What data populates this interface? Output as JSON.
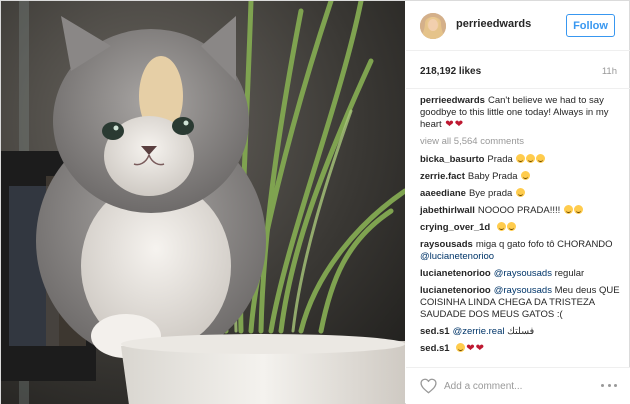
{
  "post": {
    "username": "perrieedwards",
    "follow_label": "Follow",
    "likes": "218,192 likes",
    "time": "11h",
    "caption_user": "perrieedwards",
    "caption_text": "Can't believe we had to say goodbye to this little one today! Always in my heart",
    "view_all": "view all 5,564 comments",
    "comments": [
      {
        "user": "bicka_basurto",
        "text": "Prada",
        "emojis": 3
      },
      {
        "user": "zerrie.fact",
        "text": "Baby Prada",
        "emojis": 1
      },
      {
        "user": "aaeediane",
        "text": "Bye prada",
        "emojis": 1
      },
      {
        "user": "jabethirlwall",
        "text": "NOOOO PRADA!!!!",
        "emojis": 2
      },
      {
        "user": "crying_over_1d",
        "text": "",
        "emojis": 2
      },
      {
        "user": "raysousads",
        "text": "miga q gato fofo tô CHORANDO",
        "mention": "@lucianetenorioo"
      },
      {
        "user": "lucianetenorioo",
        "mention": "@raysousads",
        "text": "regular"
      },
      {
        "user": "lucianetenorioo",
        "mention": "@raysousads",
        "text": "Meu deus QUE COISINHA LINDA CHEGA DA TRISTEZA SAUDADE DOS MEUS GATOS :("
      },
      {
        "user": "sed.s1",
        "mention": "@zerrie.real",
        "text": "فسلتك"
      },
      {
        "user": "sed.s1",
        "text": "",
        "emojis": 1,
        "hearts": 2
      }
    ],
    "add_comment_placeholder": "Add a comment..."
  },
  "icons": {
    "heart": "heart-outline-icon",
    "more": "more-options-icon",
    "caption_hearts": "broken-heart-icon"
  },
  "colors": {
    "follow_blue": "#3897f0",
    "mention": "#003569",
    "muted": "#999999",
    "heart_red": "#be1931"
  }
}
